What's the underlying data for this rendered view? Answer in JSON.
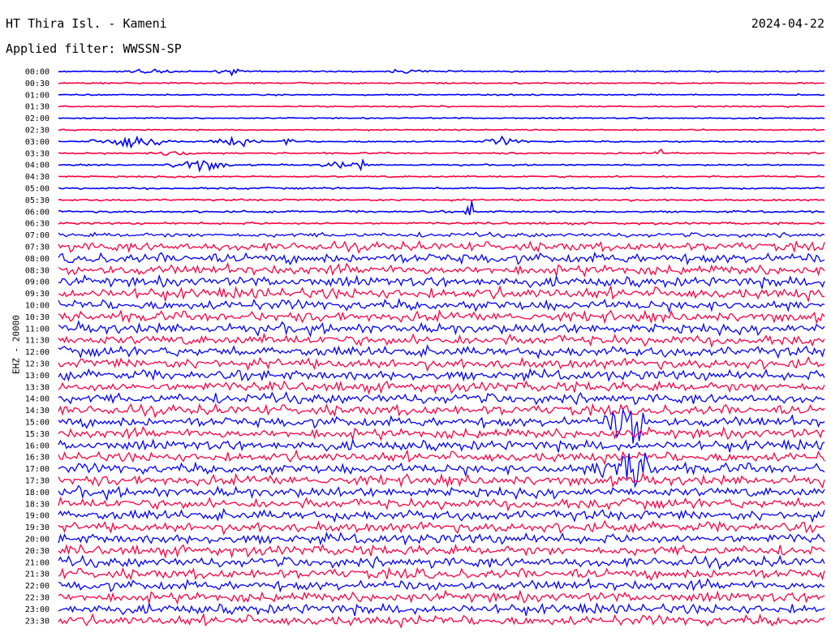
{
  "header": {
    "station": "HT Thira Isl. - Kameni",
    "date": "2024-04-22",
    "filter": "Applied filter: WWSSN-SP"
  },
  "chart_data": {
    "type": "line",
    "ylabel": "EHZ - 20000",
    "row_times": [
      "00:00",
      "00:30",
      "01:00",
      "01:30",
      "02:00",
      "02:30",
      "03:00",
      "03:30",
      "04:00",
      "04:30",
      "05:00",
      "05:30",
      "06:00",
      "06:30",
      "07:00",
      "07:30",
      "08:00",
      "08:30",
      "09:00",
      "09:30",
      "10:00",
      "10:30",
      "11:00",
      "11:30",
      "12:00",
      "12:30",
      "13:00",
      "13:30",
      "14:00",
      "14:30",
      "15:00",
      "15:30",
      "16:00",
      "16:30",
      "17:00",
      "17:30",
      "18:00",
      "18:30",
      "19:00",
      "19:30",
      "20:00",
      "20:30",
      "21:00",
      "21:30",
      "22:00",
      "22:30",
      "23:00",
      "23:30"
    ],
    "series_colors": [
      "#0000ff",
      "#ff0040"
    ],
    "row_noise_amplitude": [
      1.2,
      1.2,
      1.2,
      1.1,
      1.1,
      1.1,
      1.3,
      1.4,
      1.3,
      1.4,
      1.6,
      1.6,
      1.8,
      1.9,
      4,
      8,
      9,
      9,
      9,
      10,
      9,
      9,
      9,
      9,
      9,
      9,
      9,
      9,
      9,
      9,
      9,
      9,
      9,
      9,
      9,
      9,
      9,
      9,
      9,
      9,
      9,
      9,
      9,
      9,
      9,
      9,
      9,
      9
    ],
    "events": [
      {
        "row": 0,
        "minute": 3.6,
        "amplitude": 4,
        "duration": 1.2
      },
      {
        "row": 0,
        "minute": 6.7,
        "amplitude": 6,
        "duration": 0.6
      },
      {
        "row": 0,
        "minute": 14.0,
        "amplitude": 4,
        "duration": 1.5
      },
      {
        "row": 6,
        "minute": 2.9,
        "amplitude": 14,
        "duration": 1.8
      },
      {
        "row": 6,
        "minute": 6.9,
        "amplitude": 8,
        "duration": 1.2
      },
      {
        "row": 6,
        "minute": 9.0,
        "amplitude": 10,
        "duration": 0.3
      },
      {
        "row": 6,
        "minute": 17.5,
        "amplitude": 7,
        "duration": 1.0
      },
      {
        "row": 7,
        "minute": 4.5,
        "amplitude": 6,
        "duration": 1.0
      },
      {
        "row": 7,
        "minute": 23.6,
        "amplitude": 7,
        "duration": 0.3
      },
      {
        "row": 8,
        "minute": 5.5,
        "amplitude": 12,
        "duration": 1.4
      },
      {
        "row": 8,
        "minute": 10.8,
        "amplitude": 9,
        "duration": 0.6
      },
      {
        "row": 8,
        "minute": 11.8,
        "amplitude": 10,
        "duration": 0.5
      },
      {
        "row": 12,
        "minute": 16.2,
        "amplitude": 18,
        "duration": 0.3
      },
      {
        "row": 30,
        "minute": 22.3,
        "amplitude": 45,
        "duration": 1.0
      },
      {
        "row": 34,
        "minute": 22.2,
        "amplitude": 40,
        "duration": 1.5
      }
    ],
    "x_minutes_per_row": 30,
    "grid": false
  }
}
